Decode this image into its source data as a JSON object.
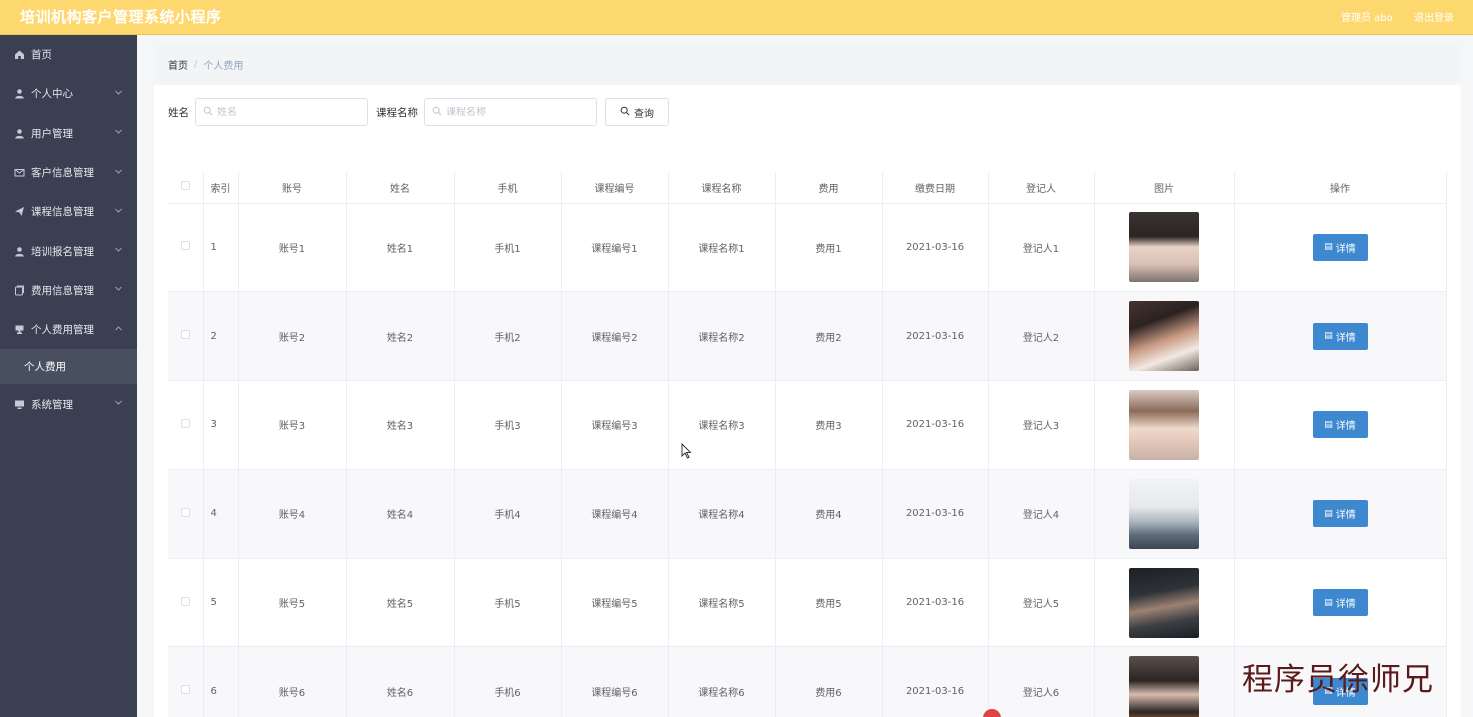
{
  "app": {
    "title": "培训机构客户管理系统小程序",
    "admin_label": "管理员 abo",
    "logout_label": "退出登录"
  },
  "sidebar": {
    "items": [
      {
        "label": "首页",
        "icon": "home-icon",
        "expandable": false
      },
      {
        "label": "个人中心",
        "icon": "user-icon",
        "expandable": true
      },
      {
        "label": "用户管理",
        "icon": "user-icon",
        "expandable": true
      },
      {
        "label": "客户信息管理",
        "icon": "mail-icon",
        "expandable": true
      },
      {
        "label": "课程信息管理",
        "icon": "send-icon",
        "expandable": true
      },
      {
        "label": "培训报名管理",
        "icon": "user-icon",
        "expandable": true
      },
      {
        "label": "费用信息管理",
        "icon": "copy-icon",
        "expandable": true
      },
      {
        "label": "个人费用管理",
        "icon": "trophy-icon",
        "expandable": true,
        "expanded": true
      },
      {
        "label": "系统管理",
        "icon": "monitor-icon",
        "expandable": true
      }
    ],
    "active_subitem": "个人费用"
  },
  "breadcrumb": {
    "home": "首页",
    "separator": "/",
    "current": "个人费用"
  },
  "search": {
    "name_label": "姓名",
    "name_placeholder": "姓名",
    "course_label": "课程名称",
    "course_placeholder": "课程名称",
    "query_label": "查询"
  },
  "table": {
    "headers": [
      "索引",
      "账号",
      "姓名",
      "手机",
      "课程编号",
      "课程名称",
      "费用",
      "缴费日期",
      "登记人",
      "图片",
      "操作"
    ],
    "detail_label": "详情",
    "rows": [
      {
        "index": "1",
        "account": "账号1",
        "name": "姓名1",
        "phone": "手机1",
        "course_no": "课程编号1",
        "course_name": "课程名称1",
        "fee": "费用1",
        "date": "2021-03-16",
        "registrar": "登记人1"
      },
      {
        "index": "2",
        "account": "账号2",
        "name": "姓名2",
        "phone": "手机2",
        "course_no": "课程编号2",
        "course_name": "课程名称2",
        "fee": "费用2",
        "date": "2021-03-16",
        "registrar": "登记人2"
      },
      {
        "index": "3",
        "account": "账号3",
        "name": "姓名3",
        "phone": "手机3",
        "course_no": "课程编号3",
        "course_name": "课程名称3",
        "fee": "费用3",
        "date": "2021-03-16",
        "registrar": "登记人3"
      },
      {
        "index": "4",
        "account": "账号4",
        "name": "姓名4",
        "phone": "手机4",
        "course_no": "课程编号4",
        "course_name": "课程名称4",
        "fee": "费用4",
        "date": "2021-03-16",
        "registrar": "登记人4"
      },
      {
        "index": "5",
        "account": "账号5",
        "name": "姓名5",
        "phone": "手机5",
        "course_no": "课程编号5",
        "course_name": "课程名称5",
        "fee": "费用5",
        "date": "2021-03-16",
        "registrar": "登记人5"
      },
      {
        "index": "6",
        "account": "账号6",
        "name": "姓名6",
        "phone": "手机6",
        "course_no": "课程编号6",
        "course_name": "课程名称6",
        "fee": "费用6",
        "date": "2021-03-16",
        "registrar": "登记人6"
      }
    ]
  },
  "watermark": "程序员徐师兄",
  "colors": {
    "topbar": "#fdd86f",
    "sidebar": "#3a3f51",
    "active_submenu": "#48505f",
    "primary_button": "#3d88cf"
  }
}
